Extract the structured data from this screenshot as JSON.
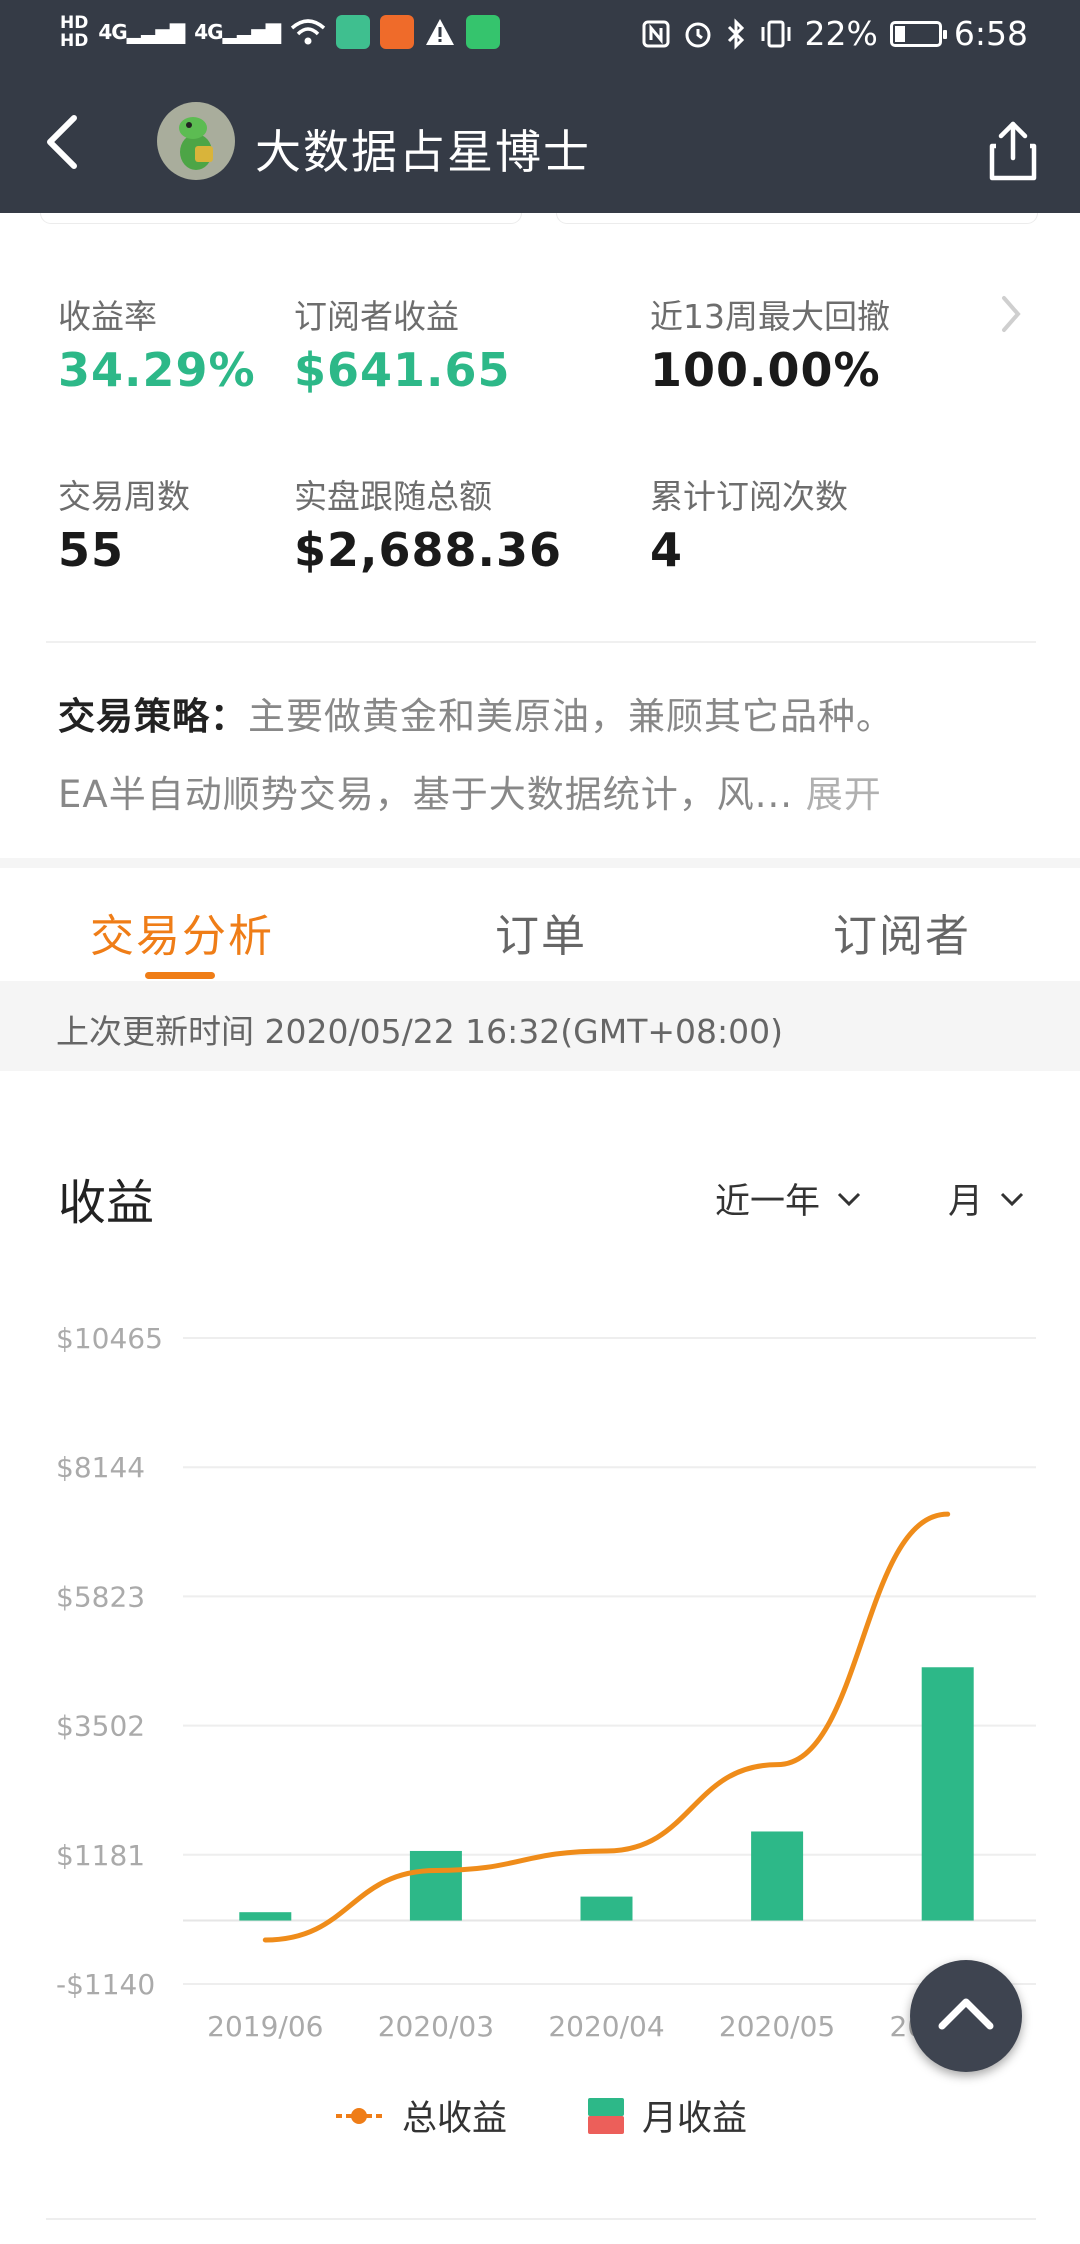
{
  "status_bar": {
    "hd1": "HD",
    "hd2": "HD",
    "net1": "4G",
    "net2": "4G",
    "battery": "22%",
    "time": "6:58"
  },
  "header": {
    "title": "大数据占星博士"
  },
  "stats": [
    {
      "label": "收益率",
      "value": "34.29%"
    },
    {
      "label": "订阅者收益",
      "value": "$641.65"
    },
    {
      "label": "近13周最大回撤",
      "value": "100.00%"
    },
    {
      "label": "交易周数",
      "value": "55"
    },
    {
      "label": "实盘跟随总额",
      "value": "$2,688.36"
    },
    {
      "label": "累计订阅次数",
      "value": "4"
    }
  ],
  "strategy": {
    "label": "交易策略：",
    "line1": "主要做黄金和美原油，兼顾其它品种。",
    "line2": "EA半自动顺势交易，基于大数据统计，风...",
    "expand": "展开"
  },
  "tabs": [
    {
      "label": "交易分析",
      "active": true
    },
    {
      "label": "订单",
      "active": false
    },
    {
      "label": "订阅者",
      "active": false
    }
  ],
  "update_time": "上次更新时间 2020/05/22 16:32(GMT+08:00)",
  "earnings": {
    "title": "收益",
    "range_select": "近一年",
    "period_select": "月"
  },
  "colors": {
    "accent_orange": "#ef7d17",
    "green": "#2db888",
    "legend_red": "#ec5f5a",
    "header_bg": "#353b46"
  },
  "chart_data": {
    "type": "bar",
    "title": "",
    "categories": [
      "2019/06",
      "2020/03",
      "2020/04",
      "2020/05",
      "2020/06"
    ],
    "series": [
      {
        "name": "月收益",
        "type": "bar",
        "values": [
          150,
          1250,
          430,
          1600,
          4550
        ]
      },
      {
        "name": "总收益",
        "type": "line",
        "values": [
          -350,
          900,
          1250,
          2800,
          7300
        ]
      }
    ],
    "y_ticks": [
      "$10465",
      "$8144",
      "$5823",
      "$3502",
      "$1181",
      "-$1140"
    ],
    "ylim": [
      -1140,
      10465
    ],
    "grid": true,
    "legend": "bottom"
  },
  "legend": {
    "total": "总收益",
    "monthly": "月收益"
  }
}
